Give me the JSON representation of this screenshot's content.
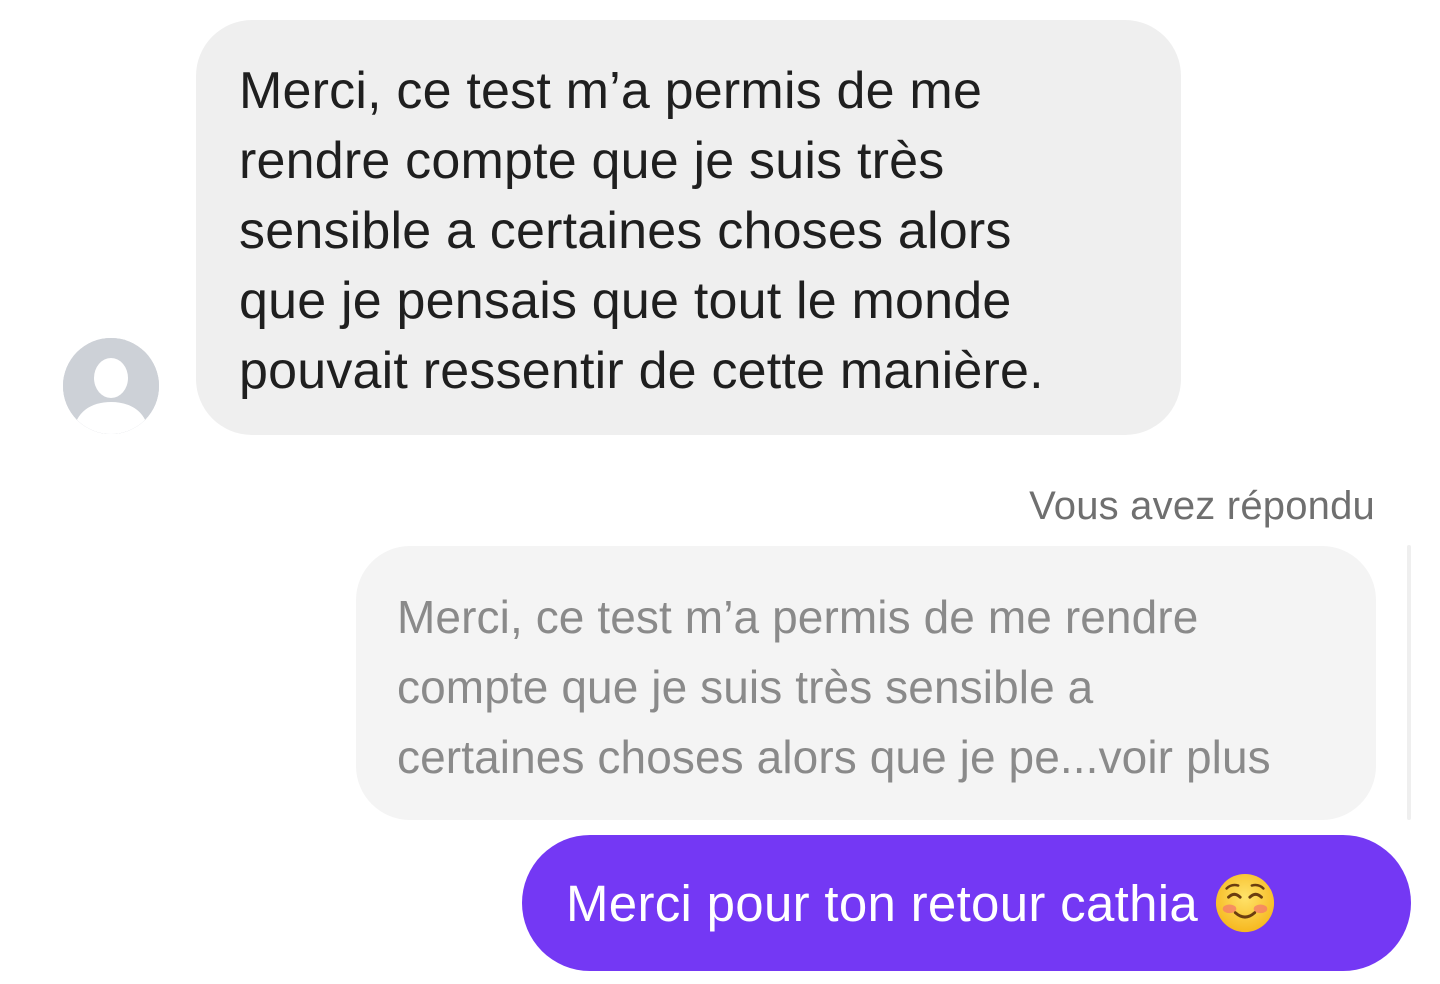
{
  "conversation": {
    "incoming_message": {
      "lines": [
        "Merci, ce test m’a permis de me",
        "rendre compte que je suis très",
        "sensible a certaines  choses alors",
        "que je pensais que tout le monde",
        "pouvait ressentir de cette manière."
      ],
      "avatar_icon": "default-user-avatar-icon"
    },
    "reply_label": "Vous avez répondu",
    "quoted_message": {
      "lines": [
        "Merci, ce test m’a permis de me rendre",
        "compte que je suis très sensible a",
        "certaines  choses alors que je pe...voir plus"
      ]
    },
    "outgoing_message": {
      "text": "Merci pour ton retour cathia",
      "emoji_icon": "smiling-face-with-blush-icon"
    }
  },
  "colors": {
    "outgoing_bubble": "#7438f4",
    "incoming_bubble": "#efefef",
    "quoted_bubble": "#f4f4f4"
  }
}
